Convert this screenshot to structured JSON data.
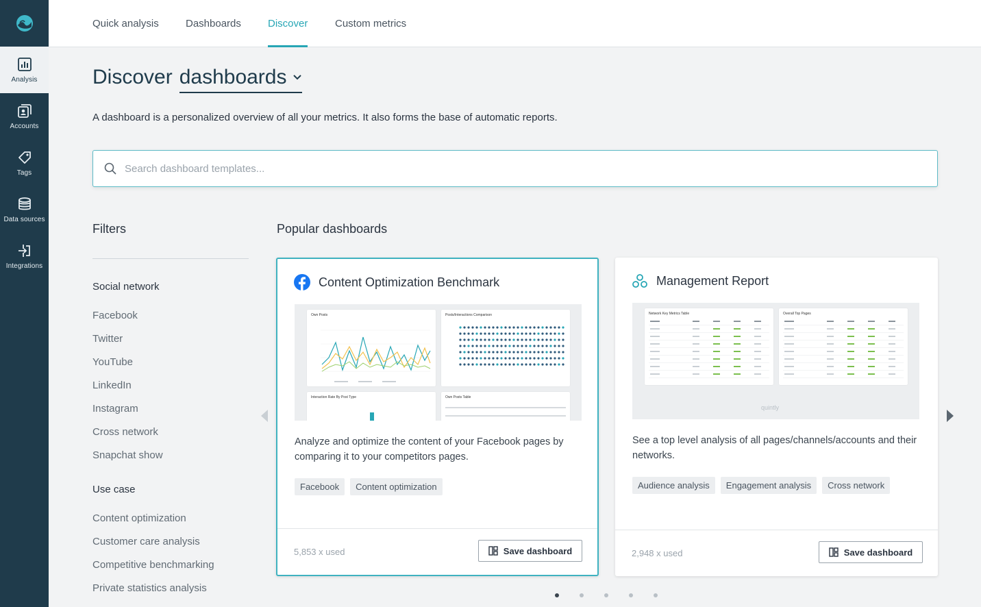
{
  "sidebar": {
    "items": [
      {
        "label": "Analysis",
        "icon": "bar-chart-icon",
        "active": true
      },
      {
        "label": "Accounts",
        "icon": "accounts-icon",
        "active": false
      },
      {
        "label": "Tags",
        "icon": "tag-icon",
        "active": false
      },
      {
        "label": "Data sources",
        "icon": "database-icon",
        "active": false
      },
      {
        "label": "Integrations",
        "icon": "integrations-icon",
        "active": false
      }
    ]
  },
  "tabs": [
    {
      "label": "Quick analysis",
      "active": false
    },
    {
      "label": "Dashboards",
      "active": false
    },
    {
      "label": "Discover",
      "active": true
    },
    {
      "label": "Custom metrics",
      "active": false
    }
  ],
  "header": {
    "title_prefix": "Discover",
    "title_dropdown": "dashboards",
    "subtitle": "A dashboard is a personalized overview of all your metrics. It also forms the base of automatic reports."
  },
  "search": {
    "placeholder": "Search dashboard templates...",
    "value": ""
  },
  "filters": {
    "title": "Filters",
    "social_network": {
      "title": "Social network",
      "items": [
        "Facebook",
        "Twitter",
        "YouTube",
        "LinkedIn",
        "Instagram",
        "Cross network",
        "Snapchat show"
      ]
    },
    "use_case": {
      "title": "Use case",
      "items": [
        "Content optimization",
        "Customer care analysis",
        "Competitive benchmarking",
        "Private statistics analysis"
      ]
    }
  },
  "popular": {
    "title": "Popular dashboards",
    "cards": [
      {
        "title": "Content Optimization Benchmark",
        "icon": "facebook-icon",
        "description": "Analyze and optimize the content of your Facebook pages by comparing it to your competitors pages.",
        "tags": [
          "Facebook",
          "Content optimization"
        ],
        "used": "5,853 x used",
        "save_label": "Save dashboard",
        "selected": true,
        "preview": {
          "widgets": [
            "Own Posts",
            "Posts/Interactions Comparison",
            "Interaction Rate By Post Type",
            "Own Posts Table"
          ]
        }
      },
      {
        "title": "Management Report",
        "icon": "network-icon",
        "description": "See a top level analysis of all pages/channels/accounts and their networks.",
        "tags": [
          "Audience analysis",
          "Engagement analysis",
          "Cross network"
        ],
        "used": "2,948 x used",
        "save_label": "Save dashboard",
        "selected": false,
        "preview": {
          "widgets": [
            "Network Key Metrics Table",
            "Overall Top Pages"
          ],
          "watermark": "quintly"
        }
      }
    ]
  },
  "pagination": {
    "count": 5,
    "active": 0
  },
  "colors": {
    "sidebar": "#1f3b4b",
    "accent": "#27a6b5",
    "facebook": "#1877f2"
  }
}
